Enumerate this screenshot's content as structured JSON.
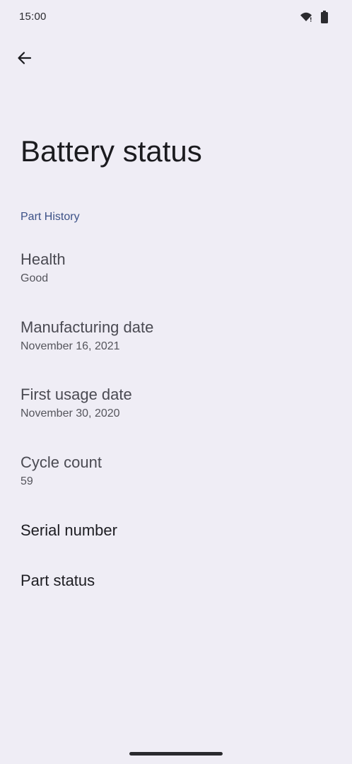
{
  "status_bar": {
    "time": "15:00",
    "icons": [
      "wifi-icon",
      "battery-icon"
    ]
  },
  "toolbar": {
    "back_icon": "arrow-back-icon"
  },
  "page": {
    "title": "Battery status"
  },
  "section": {
    "header": "Part History"
  },
  "items": [
    {
      "title": "Health",
      "summary": "Good"
    },
    {
      "title": "Manufacturing date",
      "summary": "November 16, 2021"
    },
    {
      "title": "First usage date",
      "summary": "November 30, 2020"
    },
    {
      "title": "Cycle count",
      "summary": "59"
    },
    {
      "title": "Serial number"
    },
    {
      "title": "Part status"
    }
  ],
  "colors": {
    "background": "#efedf5",
    "section_header": "#3c5187",
    "text_primary": "#1b1b1f",
    "text_secondary": "#55555c"
  }
}
